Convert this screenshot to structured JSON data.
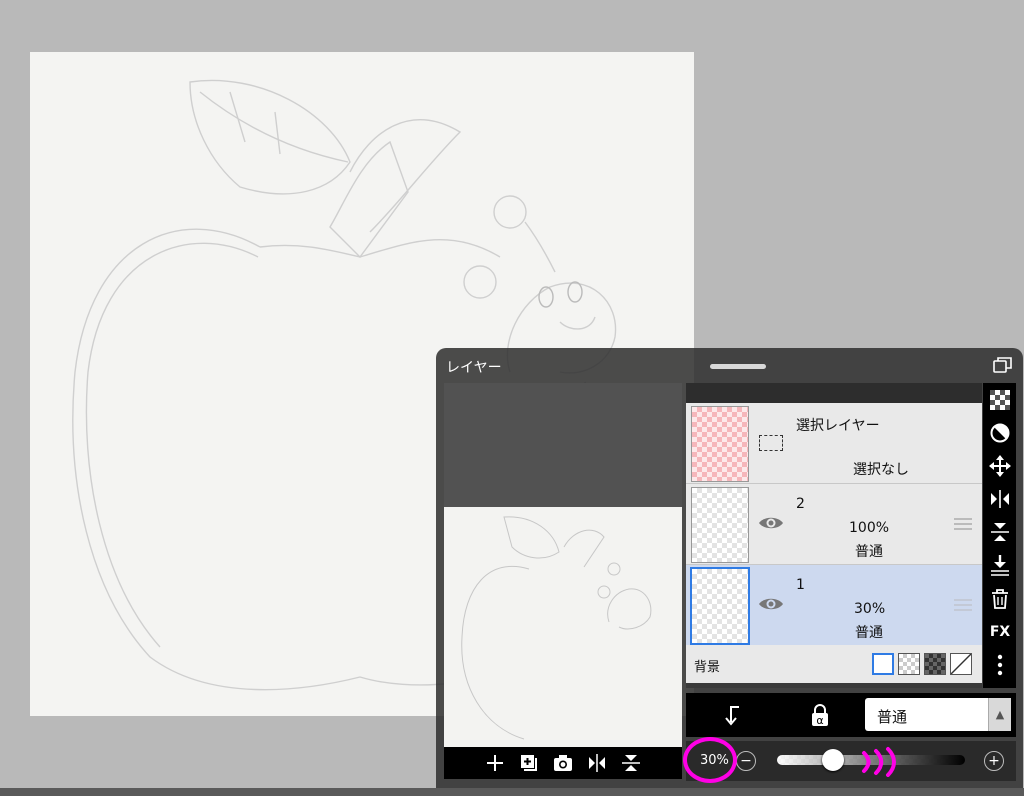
{
  "panel": {
    "title": "レイヤー"
  },
  "layers": [
    {
      "name": "選択レイヤー",
      "status": "選択なし",
      "thumb": "selection"
    },
    {
      "name": "2",
      "opacity": "100%",
      "blend": "普通"
    },
    {
      "name": "1",
      "opacity": "30%",
      "blend": "普通",
      "selected": true
    }
  ],
  "background": {
    "label": "背景",
    "swatches": [
      "white",
      "transparent",
      "dark-check",
      "none"
    ]
  },
  "blend_mode": {
    "value": "普通"
  },
  "opacity": {
    "value": "30%",
    "level": 0.3
  },
  "tools": [
    "checker-icon",
    "clip-circle-icon",
    "move-icon",
    "flip-horizontal-icon",
    "flip-vertical-icon",
    "merge-down-icon",
    "trash-icon",
    "fx-label",
    "more-icon"
  ],
  "fx_label": "FX",
  "colors": {
    "annotation": "#ff00e6",
    "selected_row": "#cdd9ef",
    "selected_border": "#2f7be4"
  }
}
